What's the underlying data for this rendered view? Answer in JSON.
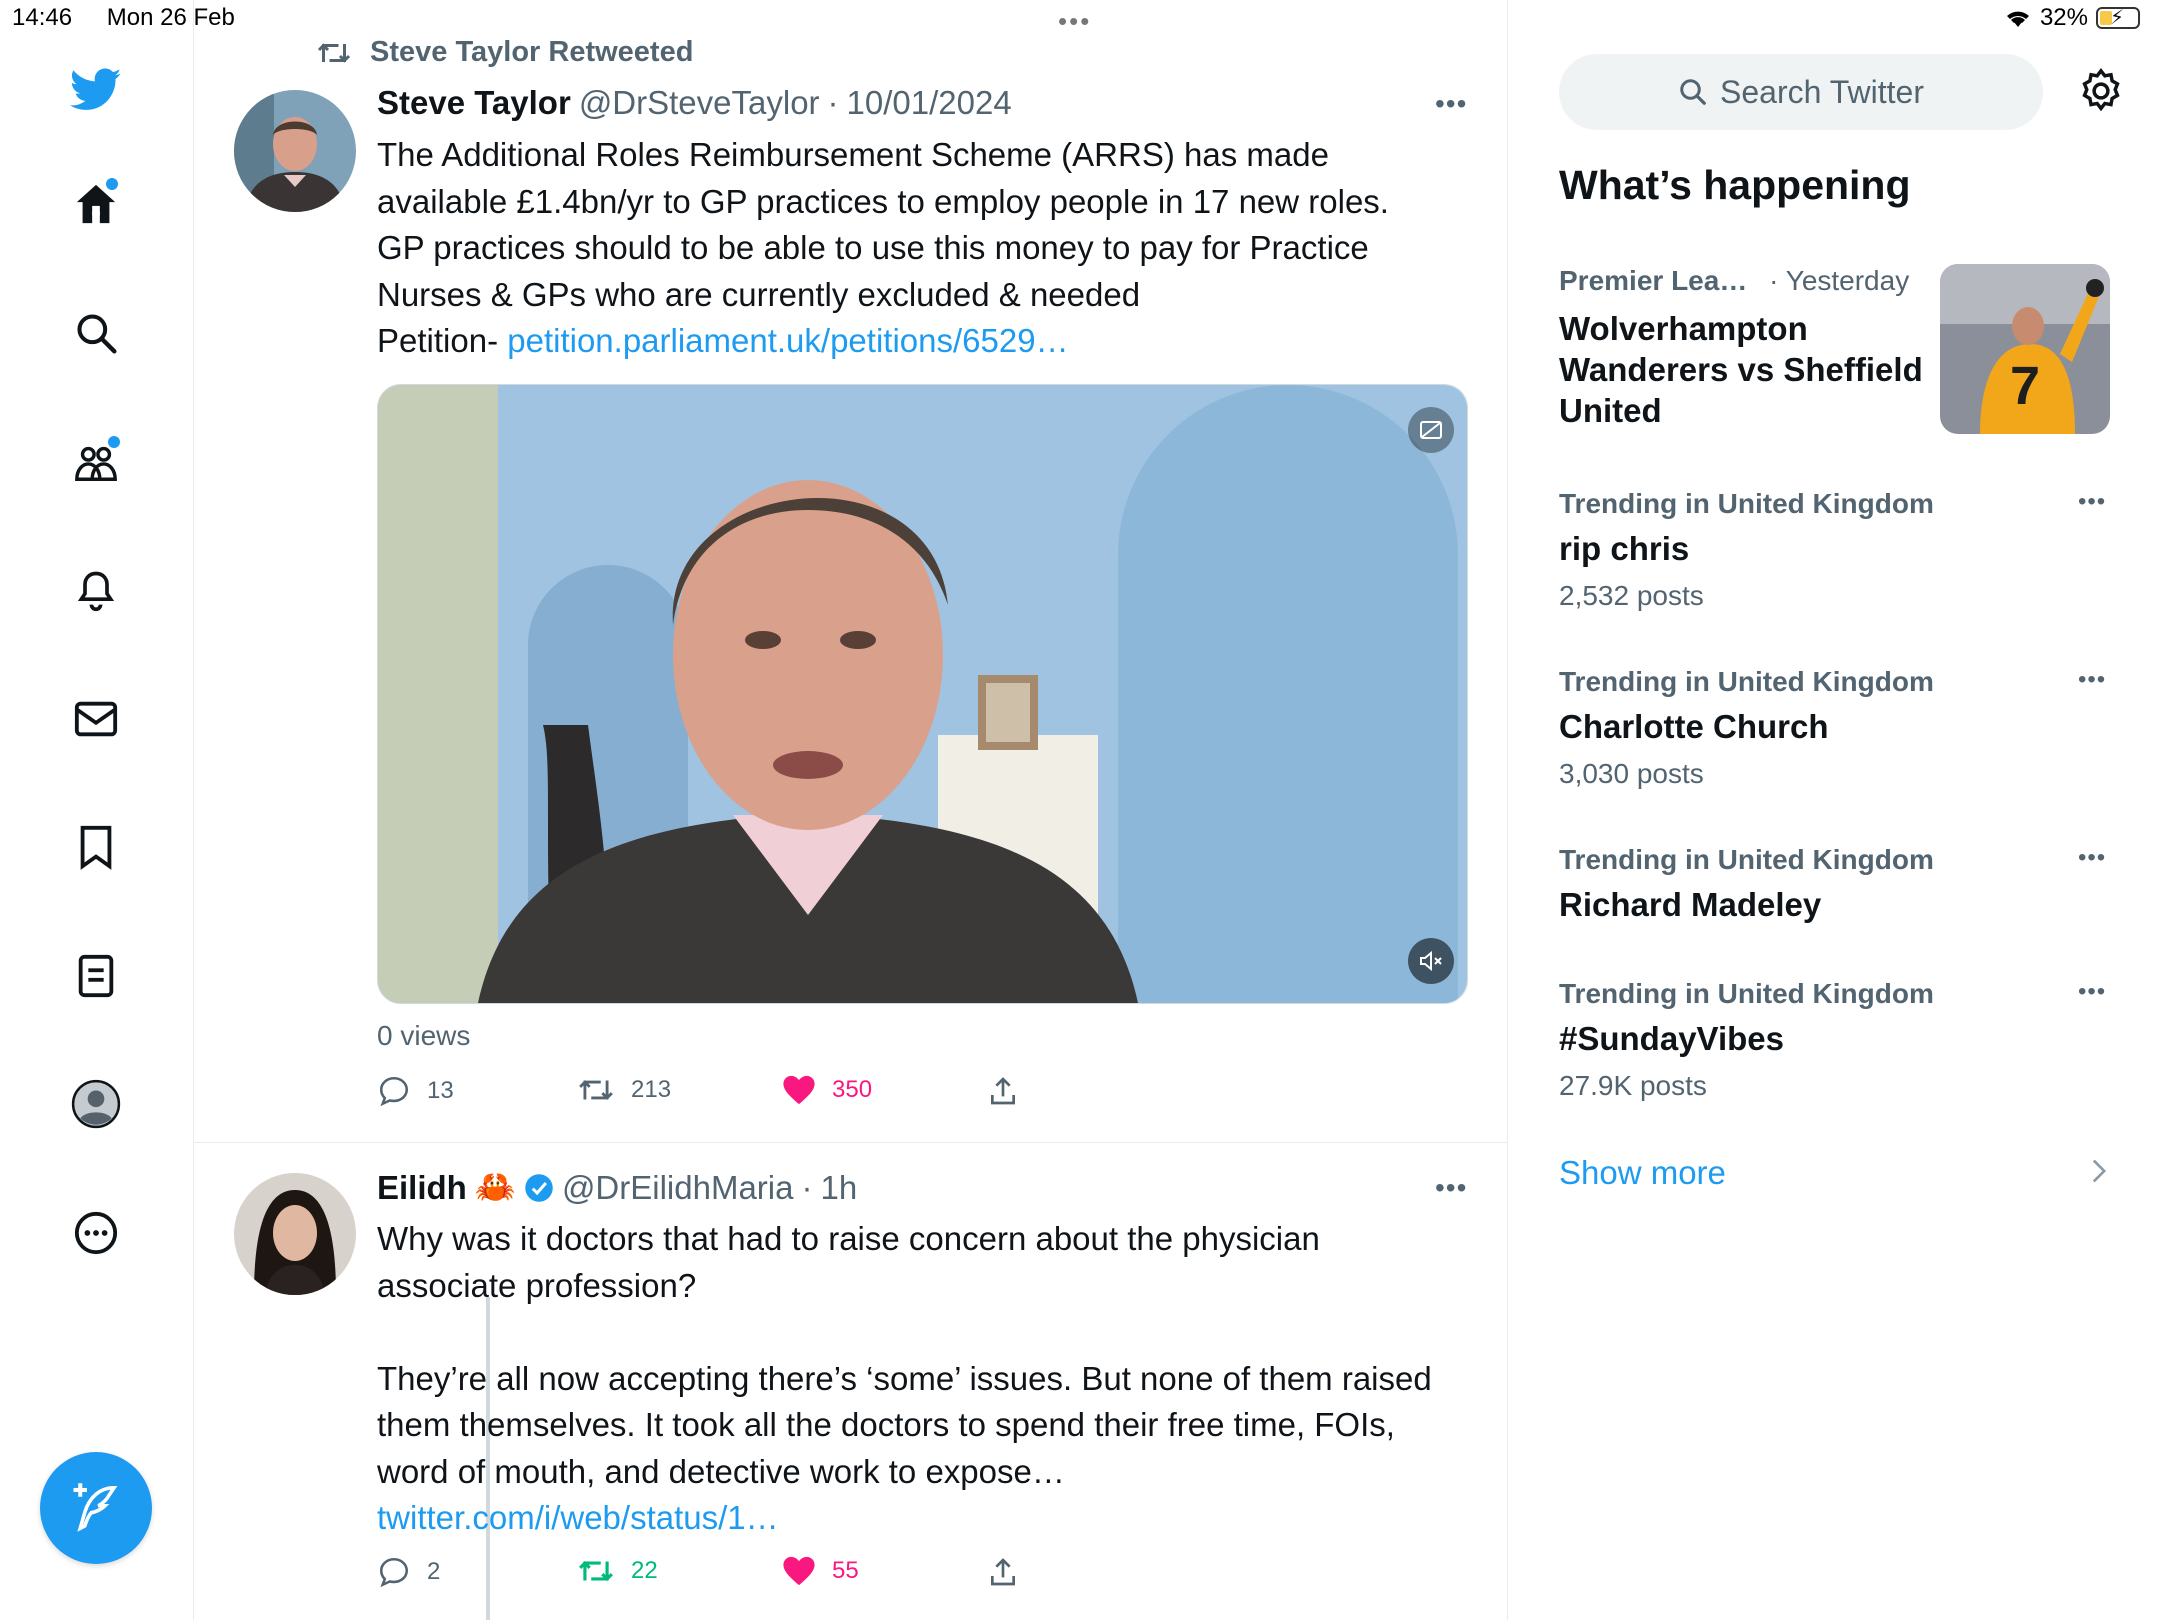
{
  "status_bar": {
    "time": "14:46",
    "date": "Mon 26 Feb",
    "battery": "32%",
    "battery_level": 0.32
  },
  "nav": {
    "items": [
      "home-icon",
      "search-icon",
      "communities-icon",
      "notifications-icon",
      "messages-icon",
      "bookmarks-icon",
      "lists-icon",
      "profile-icon",
      "more-icon"
    ]
  },
  "tweet1": {
    "retweet_label": "Steve Taylor Retweeted",
    "name": "Steve Taylor",
    "handle": "@DrSteveTaylor",
    "separator": "·",
    "date": "10/01/2024",
    "text": "The Additional Roles Reimbursement Scheme (ARRS) has made available £1.4bn/yr to GP practices to employ people in 17 new roles. GP practices should to be able to use this money to pay for Practice Nurses & GPs who are currently excluded & needed",
    "petition_prefix": "Petition- ",
    "link": "petition.parliament.uk/petitions/6529…",
    "views": "0 views",
    "replies": "13",
    "retweets": "213",
    "likes": "350"
  },
  "tweet2": {
    "name": "Eilidh",
    "emoji": "🦀",
    "handle": "@DrEilidhMaria",
    "separator": "·",
    "time": "1h",
    "text1": "Why was it doctors that had to raise concern about the physician associate profession?",
    "text2": "They’re all now accepting there’s ‘some’ issues. But none of them raised them themselves. It took all the doctors to spend their free time, FOIs, word of mouth, and detective work to expose… ",
    "link": "twitter.com/i/web/status/1…",
    "replies": "2",
    "retweets": "22",
    "likes": "55"
  },
  "sidebar": {
    "search_placeholder": "Search Twitter",
    "heading": "What’s happening",
    "featured": {
      "context": "Premier Lea…",
      "time": "· Yesterday",
      "title": "Wolverhampton Wanderers vs Sheffield United"
    },
    "trends": [
      {
        "context": "Trending in United Kingdom",
        "title": "rip chris",
        "count": "2,532 posts"
      },
      {
        "context": "Trending in United Kingdom",
        "title": "Charlotte Church",
        "count": "3,030 posts"
      },
      {
        "context": "Trending in United Kingdom",
        "title": "Richard Madeley",
        "count": ""
      },
      {
        "context": "Trending in United Kingdom",
        "title": "#SundayVibes",
        "count": "27.9K posts"
      }
    ],
    "show_more": "Show more"
  },
  "colors": {
    "accent": "#1d9bf0",
    "like": "#f91880",
    "retweet_active": "#00ba7c",
    "text_secondary": "#536471"
  }
}
